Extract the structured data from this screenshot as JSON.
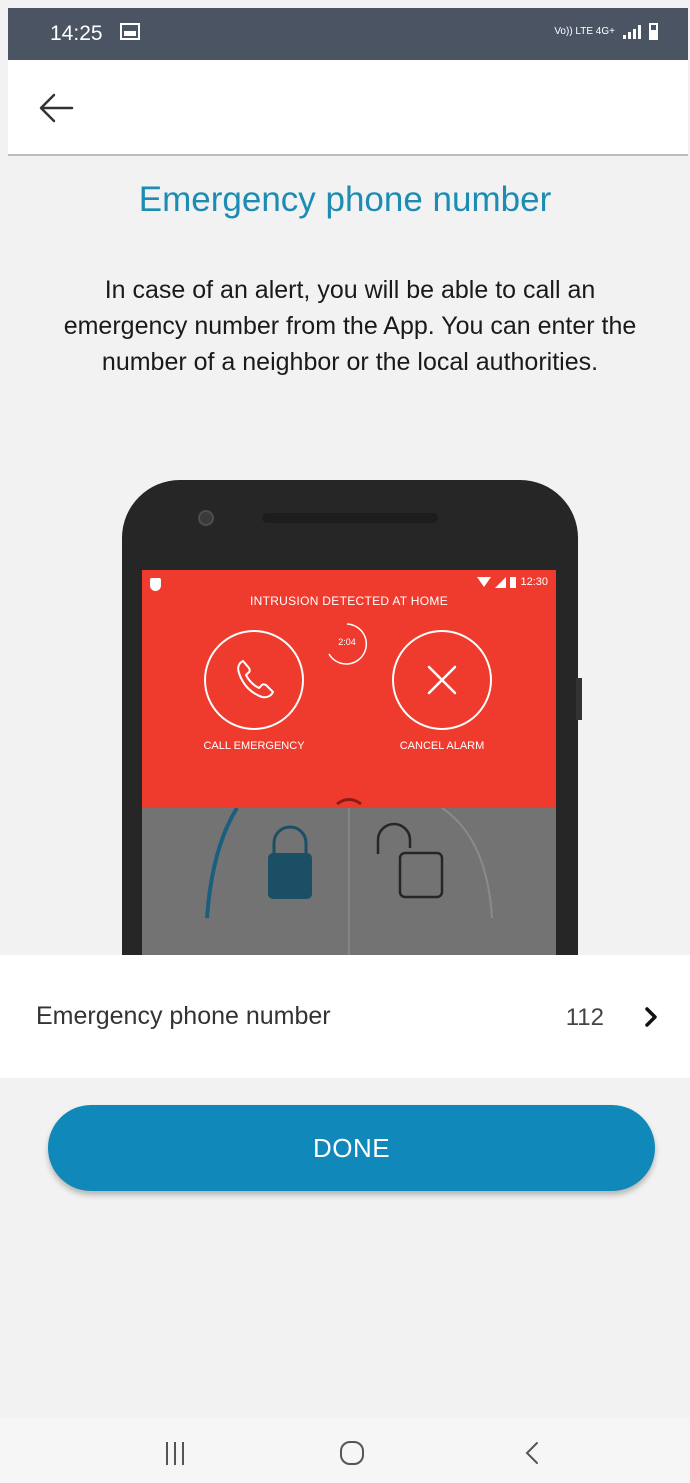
{
  "status_bar": {
    "time": "14:25",
    "network_label": "Vo)) LTE 4G+"
  },
  "header": {
    "back_icon": "arrow-left-icon"
  },
  "main": {
    "title": "Emergency phone number",
    "description": "In case of an alert, you will be able to call an emergency number from the App. You can enter the number of a neighbor or the local authorities."
  },
  "illustration": {
    "time": "12:30",
    "alert_title": "INTRUSION DETECTED AT HOME",
    "countdown": "2:04",
    "call_label": "CALL EMERGENCY",
    "cancel_label": "CANCEL ALARM"
  },
  "setting": {
    "label": "Emergency phone number",
    "value": "112"
  },
  "actions": {
    "done_label": "DONE"
  },
  "colors": {
    "accent": "#1c8cb3",
    "button": "#1088b9",
    "alert_red": "#ef3b2e",
    "status_bar": "#4b5463"
  }
}
